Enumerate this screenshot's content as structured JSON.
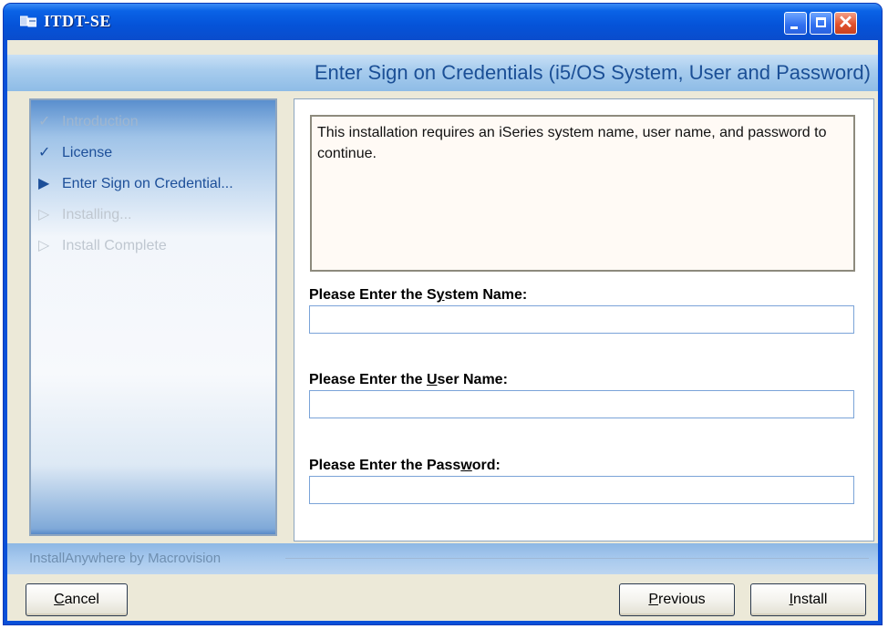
{
  "window": {
    "title": "ITDT-SE"
  },
  "header": {
    "title": "Enter Sign on Credentials (i5/OS System, User and Password)"
  },
  "steps": [
    {
      "mark": "✓",
      "label": "Introduction",
      "state": "done-dim"
    },
    {
      "mark": "✓",
      "label": "License",
      "state": "done"
    },
    {
      "mark": "▶",
      "label": "Enter Sign on Credential...",
      "state": "current"
    },
    {
      "mark": "▷",
      "label": "Installing...",
      "state": "pending"
    },
    {
      "mark": "▷",
      "label": "Install Complete",
      "state": "pending"
    }
  ],
  "description": "This installation requires an iSeries system name, user name, and password to continue.",
  "fields": {
    "system": {
      "label_pre": "Please Enter the S",
      "label_key": "y",
      "label_post": "stem Name:",
      "value": ""
    },
    "user": {
      "label_pre": "Please Enter the ",
      "label_key": "U",
      "label_post": "ser Name:",
      "value": ""
    },
    "password": {
      "label_pre": "Please Enter the Pass",
      "label_key": "w",
      "label_post": "ord:",
      "value": ""
    }
  },
  "footer": {
    "vendor": "InstallAnywhere by Macrovision"
  },
  "buttons": {
    "cancel": {
      "key": "C",
      "rest": "ancel"
    },
    "previous": {
      "key": "P",
      "rest": "revious"
    },
    "install": {
      "key": "I",
      "rest": "nstall"
    }
  },
  "colors": {
    "titlebar": "#0553d8",
    "accent_text": "#1d4f99",
    "header_band": "#a9cdee"
  },
  "icons": {
    "app": "installer-window-icon",
    "minimize": "minimize-icon",
    "maximize": "maximize-icon",
    "close": "close-icon"
  }
}
